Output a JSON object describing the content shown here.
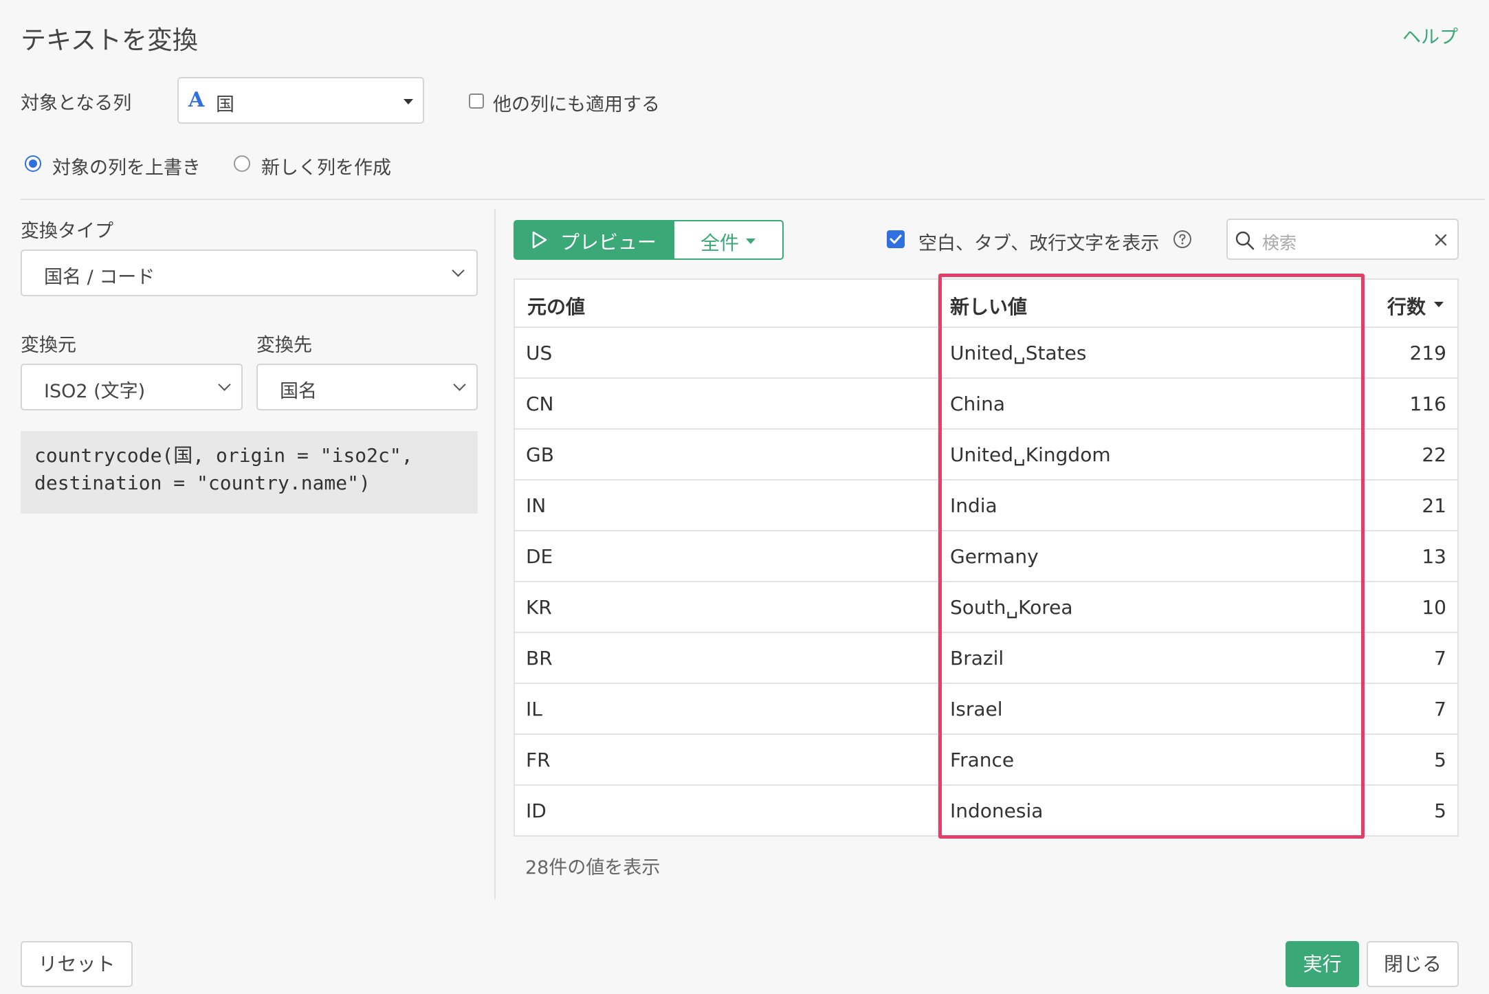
{
  "header": {
    "title": "テキストを変換",
    "help": "ヘルプ"
  },
  "target_column": {
    "label": "対象となる列",
    "type_icon": "A",
    "value": "国",
    "apply_other_label": "他の列にも適用する"
  },
  "output_mode": {
    "overwrite_label": "対象の列を上書き",
    "new_column_label": "新しく列を作成",
    "selected": "overwrite"
  },
  "conversion": {
    "type_label": "変換タイプ",
    "type_value": "国名 / コード",
    "source_label": "変換元",
    "source_value": "ISO2 (文字)",
    "dest_label": "変換先",
    "dest_value": "国名",
    "code_line1": "countrycode(国, origin = \"iso2c\",",
    "code_line2": "destination = \"country.name\")"
  },
  "preview_bar": {
    "preview_label": "プレビュー",
    "all_label": "全件",
    "show_whitespace_label": "空白、タブ、改行文字を表示",
    "search_placeholder": "検索"
  },
  "table": {
    "headers": {
      "original": "元の値",
      "new": "新しい値",
      "count": "行数"
    },
    "rows": [
      {
        "original": "US",
        "new": "United␣States",
        "count": "219"
      },
      {
        "original": "CN",
        "new": "China",
        "count": "116"
      },
      {
        "original": "GB",
        "new": "United␣Kingdom",
        "count": "22"
      },
      {
        "original": "IN",
        "new": "India",
        "count": "21"
      },
      {
        "original": "DE",
        "new": "Germany",
        "count": "13"
      },
      {
        "original": "KR",
        "new": "South␣Korea",
        "count": "10"
      },
      {
        "original": "BR",
        "new": "Brazil",
        "count": "7"
      },
      {
        "original": "IL",
        "new": "Israel",
        "count": "7"
      },
      {
        "original": "FR",
        "new": "France",
        "count": "5"
      },
      {
        "original": "ID",
        "new": "Indonesia",
        "count": "5"
      }
    ],
    "footer": "28件の値を表示"
  },
  "footer": {
    "reset": "リセット",
    "run": "実行",
    "close": "閉じる"
  },
  "colors": {
    "accent_green": "#3aa877",
    "highlight": "#e23f6b",
    "blue": "#2f6fe0"
  }
}
